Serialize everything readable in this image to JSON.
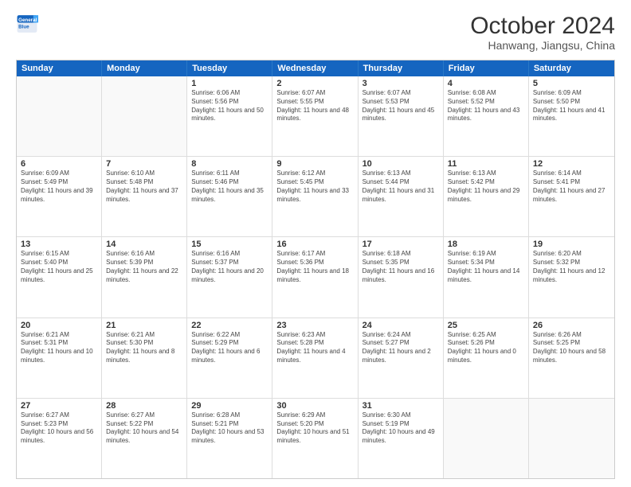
{
  "logo": {
    "line1": "General",
    "line2": "Blue"
  },
  "title": "October 2024",
  "subtitle": "Hanwang, Jiangsu, China",
  "header": {
    "days": [
      "Sunday",
      "Monday",
      "Tuesday",
      "Wednesday",
      "Thursday",
      "Friday",
      "Saturday"
    ]
  },
  "rows": [
    [
      {
        "day": "",
        "info": ""
      },
      {
        "day": "",
        "info": ""
      },
      {
        "day": "1",
        "info": "Sunrise: 6:06 AM\nSunset: 5:56 PM\nDaylight: 11 hours and 50 minutes."
      },
      {
        "day": "2",
        "info": "Sunrise: 6:07 AM\nSunset: 5:55 PM\nDaylight: 11 hours and 48 minutes."
      },
      {
        "day": "3",
        "info": "Sunrise: 6:07 AM\nSunset: 5:53 PM\nDaylight: 11 hours and 45 minutes."
      },
      {
        "day": "4",
        "info": "Sunrise: 6:08 AM\nSunset: 5:52 PM\nDaylight: 11 hours and 43 minutes."
      },
      {
        "day": "5",
        "info": "Sunrise: 6:09 AM\nSunset: 5:50 PM\nDaylight: 11 hours and 41 minutes."
      }
    ],
    [
      {
        "day": "6",
        "info": "Sunrise: 6:09 AM\nSunset: 5:49 PM\nDaylight: 11 hours and 39 minutes."
      },
      {
        "day": "7",
        "info": "Sunrise: 6:10 AM\nSunset: 5:48 PM\nDaylight: 11 hours and 37 minutes."
      },
      {
        "day": "8",
        "info": "Sunrise: 6:11 AM\nSunset: 5:46 PM\nDaylight: 11 hours and 35 minutes."
      },
      {
        "day": "9",
        "info": "Sunrise: 6:12 AM\nSunset: 5:45 PM\nDaylight: 11 hours and 33 minutes."
      },
      {
        "day": "10",
        "info": "Sunrise: 6:13 AM\nSunset: 5:44 PM\nDaylight: 11 hours and 31 minutes."
      },
      {
        "day": "11",
        "info": "Sunrise: 6:13 AM\nSunset: 5:42 PM\nDaylight: 11 hours and 29 minutes."
      },
      {
        "day": "12",
        "info": "Sunrise: 6:14 AM\nSunset: 5:41 PM\nDaylight: 11 hours and 27 minutes."
      }
    ],
    [
      {
        "day": "13",
        "info": "Sunrise: 6:15 AM\nSunset: 5:40 PM\nDaylight: 11 hours and 25 minutes."
      },
      {
        "day": "14",
        "info": "Sunrise: 6:16 AM\nSunset: 5:39 PM\nDaylight: 11 hours and 22 minutes."
      },
      {
        "day": "15",
        "info": "Sunrise: 6:16 AM\nSunset: 5:37 PM\nDaylight: 11 hours and 20 minutes."
      },
      {
        "day": "16",
        "info": "Sunrise: 6:17 AM\nSunset: 5:36 PM\nDaylight: 11 hours and 18 minutes."
      },
      {
        "day": "17",
        "info": "Sunrise: 6:18 AM\nSunset: 5:35 PM\nDaylight: 11 hours and 16 minutes."
      },
      {
        "day": "18",
        "info": "Sunrise: 6:19 AM\nSunset: 5:34 PM\nDaylight: 11 hours and 14 minutes."
      },
      {
        "day": "19",
        "info": "Sunrise: 6:20 AM\nSunset: 5:32 PM\nDaylight: 11 hours and 12 minutes."
      }
    ],
    [
      {
        "day": "20",
        "info": "Sunrise: 6:21 AM\nSunset: 5:31 PM\nDaylight: 11 hours and 10 minutes."
      },
      {
        "day": "21",
        "info": "Sunrise: 6:21 AM\nSunset: 5:30 PM\nDaylight: 11 hours and 8 minutes."
      },
      {
        "day": "22",
        "info": "Sunrise: 6:22 AM\nSunset: 5:29 PM\nDaylight: 11 hours and 6 minutes."
      },
      {
        "day": "23",
        "info": "Sunrise: 6:23 AM\nSunset: 5:28 PM\nDaylight: 11 hours and 4 minutes."
      },
      {
        "day": "24",
        "info": "Sunrise: 6:24 AM\nSunset: 5:27 PM\nDaylight: 11 hours and 2 minutes."
      },
      {
        "day": "25",
        "info": "Sunrise: 6:25 AM\nSunset: 5:26 PM\nDaylight: 11 hours and 0 minutes."
      },
      {
        "day": "26",
        "info": "Sunrise: 6:26 AM\nSunset: 5:25 PM\nDaylight: 10 hours and 58 minutes."
      }
    ],
    [
      {
        "day": "27",
        "info": "Sunrise: 6:27 AM\nSunset: 5:23 PM\nDaylight: 10 hours and 56 minutes."
      },
      {
        "day": "28",
        "info": "Sunrise: 6:27 AM\nSunset: 5:22 PM\nDaylight: 10 hours and 54 minutes."
      },
      {
        "day": "29",
        "info": "Sunrise: 6:28 AM\nSunset: 5:21 PM\nDaylight: 10 hours and 53 minutes."
      },
      {
        "day": "30",
        "info": "Sunrise: 6:29 AM\nSunset: 5:20 PM\nDaylight: 10 hours and 51 minutes."
      },
      {
        "day": "31",
        "info": "Sunrise: 6:30 AM\nSunset: 5:19 PM\nDaylight: 10 hours and 49 minutes."
      },
      {
        "day": "",
        "info": ""
      },
      {
        "day": "",
        "info": ""
      }
    ]
  ]
}
